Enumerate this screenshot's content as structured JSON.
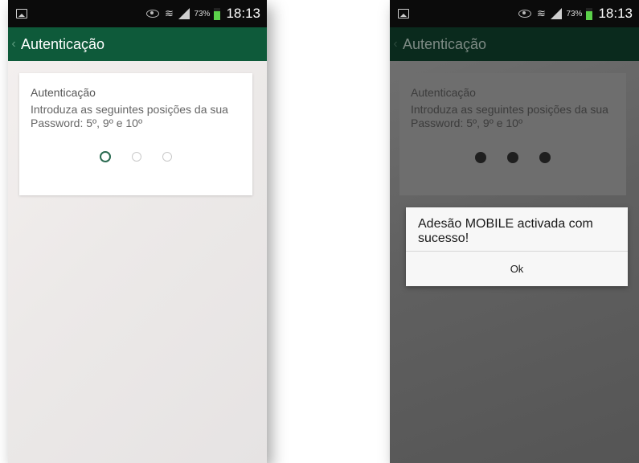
{
  "left_screen": {
    "status_bar": {
      "battery_pct": "73%",
      "time": "18:13",
      "icons": [
        "gallery-notification-icon",
        "eye-icon",
        "wifi-icon",
        "signal-icon",
        "battery-icon"
      ]
    },
    "app_bar": {
      "title": "Autenticação",
      "back_icon": "chevron-left-icon"
    },
    "card": {
      "title": "Autenticação",
      "instructions": "Introduza as seguintes posições da sua Password: 5º, 9º e 10º",
      "pin_positions": [
        "empty-active",
        "empty",
        "empty"
      ]
    }
  },
  "right_screen": {
    "status_bar": {
      "battery_pct": "73%",
      "time": "18:13",
      "icons": [
        "gallery-notification-icon",
        "eye-icon",
        "wifi-icon",
        "signal-icon",
        "battery-icon"
      ]
    },
    "app_bar": {
      "title": "Autenticação",
      "back_icon": "chevron-left-icon"
    },
    "card": {
      "title": "Autenticação",
      "instructions": "Introduza as seguintes posições da sua Password: 5º, 9º e 10º",
      "pin_positions": [
        "filled",
        "filled",
        "filled"
      ]
    },
    "dialog": {
      "message": "Adesão MOBILE activada com sucesso!",
      "button_label": "Ok"
    }
  },
  "colors": {
    "app_bar": "#0e5a3a",
    "status_bar": "#0b0b0b",
    "battery": "#5bd14a",
    "active_dot": "#2a6a50"
  }
}
